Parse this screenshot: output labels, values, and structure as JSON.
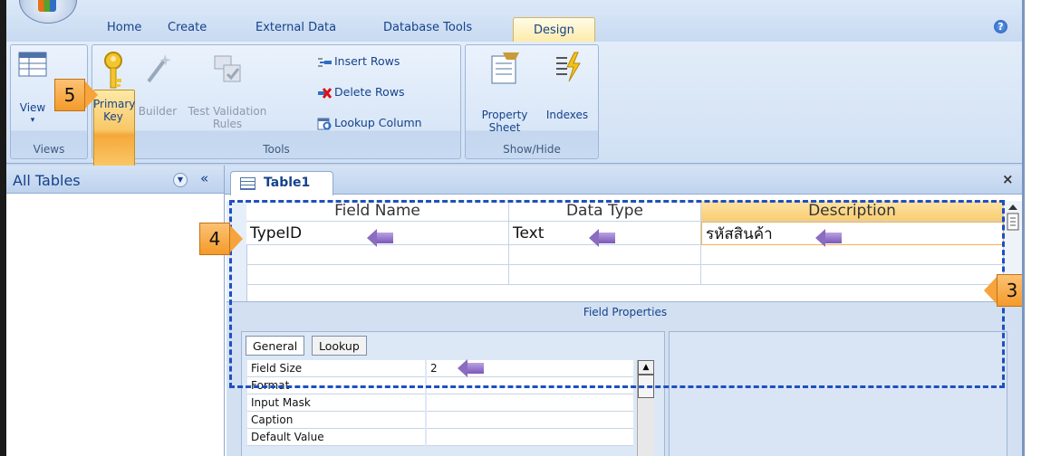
{
  "ribbon": {
    "tabs": [
      "Home",
      "Create",
      "External Data",
      "Database Tools",
      "Design"
    ],
    "active_tab": "Design",
    "groups": {
      "views": {
        "label": "Views",
        "view_label": "View"
      },
      "tools": {
        "label": "Tools",
        "primary_key_label": "Primary",
        "primary_key_label2": "Key",
        "builder_label": "Builder",
        "test_validation_label": "Test Validation",
        "test_validation_label2": "Rules",
        "insert_rows_label": "Insert Rows",
        "delete_rows_label": "Delete Rows",
        "lookup_column_label": "Lookup Column"
      },
      "show_hide": {
        "label": "Show/Hide",
        "property_sheet_label": "Property",
        "property_sheet_label2": "Sheet",
        "indexes_label": "Indexes"
      }
    }
  },
  "nav": {
    "title": "All Tables",
    "collapse": "«"
  },
  "document": {
    "tab_label": "Table1",
    "close_symbol": "×",
    "columns": [
      "Field Name",
      "Data Type",
      "Description"
    ],
    "rows": [
      {
        "field_name": "TypeID",
        "data_type": "Text",
        "description": "รหัสสินค้า"
      }
    ],
    "field_properties_label": "Field Properties",
    "property_tabs": [
      "General",
      "Lookup"
    ],
    "properties": [
      {
        "label": "Field Size",
        "value": "2"
      },
      {
        "label": "Format",
        "value": ""
      },
      {
        "label": "Input Mask",
        "value": ""
      },
      {
        "label": "Caption",
        "value": ""
      },
      {
        "label": "Default Value",
        "value": ""
      }
    ]
  },
  "annotations": {
    "step3": "3",
    "step4": "4",
    "step5": "5"
  },
  "colors": {
    "accent_orange": "#f49a2a",
    "dash_blue": "#1f4fc0",
    "arrow_purple": "#8a6cc0",
    "ribbon_blue": "#c8daf1"
  }
}
